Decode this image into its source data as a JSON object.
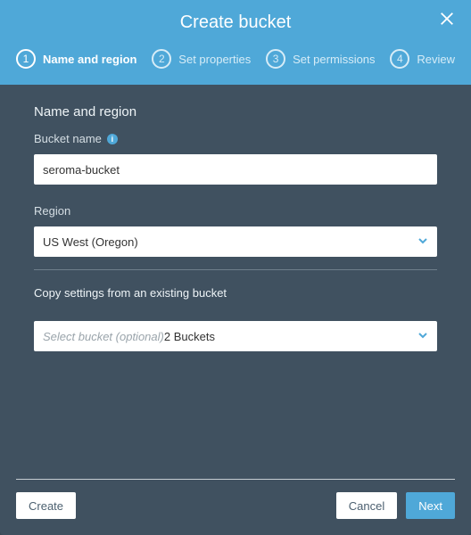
{
  "header": {
    "title": "Create bucket"
  },
  "steps": [
    {
      "num": "1",
      "label": "Name and region"
    },
    {
      "num": "2",
      "label": "Set properties"
    },
    {
      "num": "3",
      "label": "Set permissions"
    },
    {
      "num": "4",
      "label": "Review"
    }
  ],
  "section": {
    "heading": "Name and region",
    "bucket_name_label": "Bucket name",
    "bucket_name_value": "seroma-bucket",
    "region_label": "Region",
    "region_value": "US West (Oregon)",
    "copy_label": "Copy settings from an existing bucket",
    "copy_placeholder": "Select bucket (optional)",
    "copy_suffix": "2 Buckets"
  },
  "footer": {
    "create": "Create",
    "cancel": "Cancel",
    "next": "Next"
  }
}
